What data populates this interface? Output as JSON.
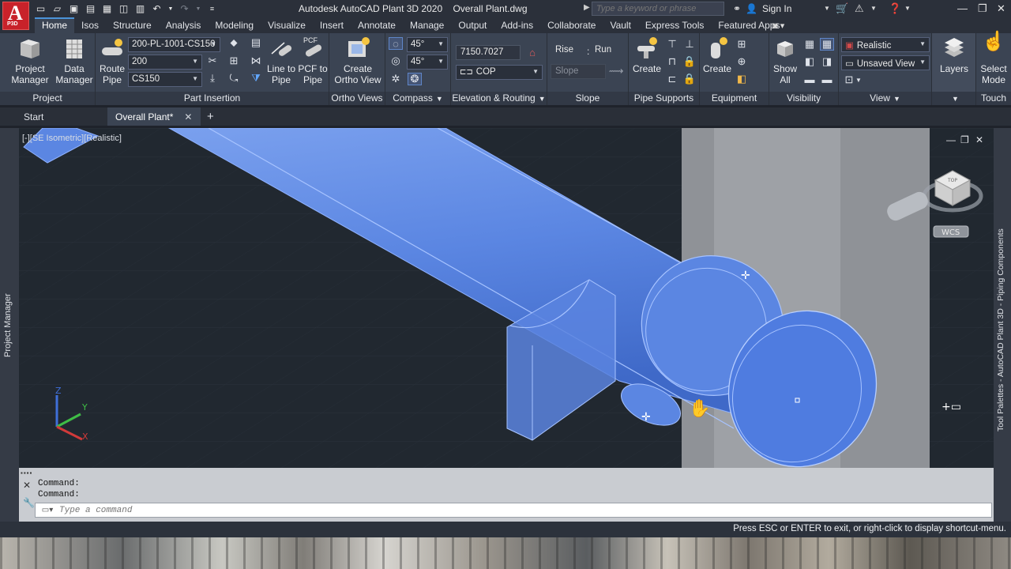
{
  "app": {
    "badge": "P3D",
    "title": "Autodesk AutoCAD Plant 3D 2020",
    "document": "Overall Plant.dwg"
  },
  "search": {
    "placeholder": "Type a keyword or phrase"
  },
  "account": {
    "sign_in": "Sign In"
  },
  "menu_tabs": [
    "Home",
    "Isos",
    "Structure",
    "Analysis",
    "Modeling",
    "Visualize",
    "Insert",
    "Annotate",
    "Manage",
    "Output",
    "Add-ins",
    "Collaborate",
    "Vault",
    "Express Tools",
    "Featured Apps"
  ],
  "ribbon": {
    "project": {
      "title": "Project",
      "project_manager": "Project Manager",
      "data_manager": "Data Manager"
    },
    "part_insertion": {
      "title": "Part Insertion",
      "route_pipe": "Route Pipe",
      "spec": "200-PL-1001-CS150",
      "size": "200",
      "pipe_spec": "CS150",
      "line_to_pipe": "Line to Pipe",
      "pcf_to_pipe": "PCF to Pipe",
      "pcf_label": "PCF"
    },
    "ortho_views": {
      "title": "Ortho Views",
      "create_ortho_view": "Create Ortho View"
    },
    "compass": {
      "title": "Compass",
      "angle1": "45°",
      "angle2": "45°"
    },
    "elevation": {
      "title": "Elevation & Routing",
      "elevation_value": "7150.7027",
      "cop": "COP"
    },
    "slope": {
      "title": "Slope",
      "rise": "Rise",
      "sep": ":",
      "run": "Run",
      "slope_placeholder": "Slope"
    },
    "pipe_supports": {
      "title": "Pipe Supports",
      "create": "Create"
    },
    "equipment": {
      "title": "Equipment",
      "create": "Create"
    },
    "visibility": {
      "title": "Visibility",
      "show_all": "Show All"
    },
    "view": {
      "title": "View",
      "visual_style": "Realistic",
      "named_view": "Unsaved View"
    },
    "layers": {
      "label": "Layers"
    },
    "touch": {
      "title": "Touch",
      "select_mode": "Select Mode"
    }
  },
  "doc_tabs": [
    {
      "label": "Start"
    },
    {
      "label": "Overall Plant*"
    }
  ],
  "viewport": {
    "label": "[-][SE Isometric][Realistic]",
    "wcs": "WCS",
    "axes": {
      "x": "X",
      "y": "Y",
      "z": "Z"
    },
    "cube_face": "TOP"
  },
  "left_palette": "Project Manager",
  "right_palette": "Tool Palettes - AutoCAD Plant 3D - Piping Components",
  "command": {
    "lines": [
      "Command:",
      "Command:"
    ],
    "placeholder": "Type a command"
  },
  "status": {
    "message": "Press ESC or ENTER to exit, or right-click to display shortcut-menu."
  },
  "colors": {
    "pipe": "#5b86e2",
    "ribbon": "#3b4453",
    "viewport": "#212830"
  }
}
